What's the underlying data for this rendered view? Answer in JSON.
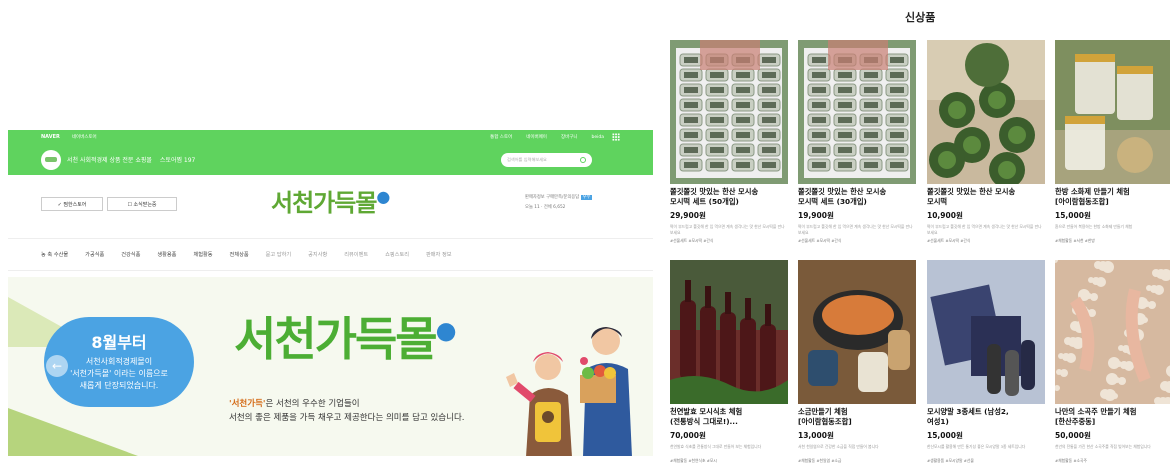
{
  "store": {
    "topbar": {
      "naver": "NAVER",
      "smartstore": "네이버스토어",
      "links": [
        "통합 스토어",
        "네이버페이",
        "장바구니",
        "beida"
      ]
    },
    "header": {
      "description": "서천 사회적경제 상품 전문 쇼핑몰",
      "store_count": "스토어찜 197",
      "search_placeholder": "검색어를 입력해보세요"
    },
    "buttons": {
      "favorite": "✓ 찜한스토어",
      "subscribe": "☐ 소식받는중"
    },
    "logo": "서천가득몰",
    "info": {
      "line1": "판매자정보  구매만족/문의응답",
      "badge": "우수",
      "line2": "오늘 11 · 전체 6,652"
    },
    "categories": [
      {
        "label": "농 축 수산물",
        "dim": false
      },
      {
        "label": "가공식품",
        "dim": false
      },
      {
        "label": "건강식품",
        "dim": false
      },
      {
        "label": "생활용품",
        "dim": false
      },
      {
        "label": "체험활동",
        "dim": false
      },
      {
        "label": "전체상품",
        "dim": false
      },
      {
        "label": "묻고 답하기",
        "dim": true
      },
      {
        "label": "공지사항",
        "dim": true
      },
      {
        "label": "리뷰이벤트",
        "dim": true
      },
      {
        "label": "쇼핑스토리",
        "dim": true
      },
      {
        "label": "판매자 정보",
        "dim": true
      }
    ],
    "banner": {
      "bubble_title": "8월부터",
      "bubble_line1": "서천사회적경제몰이",
      "bubble_line2": "'서천가득몰' 이라는 이름으로",
      "bubble_line3": "새롭게 단장되었습니다.",
      "logo": "서천가득몰",
      "sub_highlight": "'서천가득'",
      "sub_line1_rest": "은 서천의 우수한 기업들이",
      "sub_line2": "서천의 좋은 제품을 가득 채우고 제공한다는 의미를 담고 있습니다."
    }
  },
  "new_products": {
    "title": "신상품",
    "items": [
      {
        "name1": "쫄깃쫄깃 맛있는 한산 모시송",
        "name2": "모시떡 세트 (50개입)",
        "price": "29,900원",
        "desc": "떡이 부드럽고 쫄깃해 한 입 먹으면 계속 생각나는 맛 한산 모시떡을 만나보세요",
        "tags": "#선물세트 #모시떡 #간식",
        "img": "riceA"
      },
      {
        "name1": "쫄깃쫄깃 맛있는 한산 모시송",
        "name2": "모시떡 세트 (30개입)",
        "price": "19,900원",
        "desc": "떡이 부드럽고 쫄깃해 한 입 먹으면 계속 생각나는 맛 한산 모시떡을 만나보세요",
        "tags": "#선물세트 #모시떡 #간식",
        "img": "riceA"
      },
      {
        "name1": "쫄깃쫄깃 맛있는 한산 모시송",
        "name2": "모시떡",
        "price": "10,900원",
        "desc": "떡이 부드럽고 쫄깃해 한 입 먹으면 계속 생각나는 맛 한산 모시떡을 만나보세요",
        "tags": "#선물세트 #모시떡 #간식",
        "img": "greencake"
      },
      {
        "name1": "한방 소화제 만들기 체험",
        "name2": "[아이람협동조합]",
        "price": "15,000원",
        "desc": "환으로 만들어 복용하는 한방 소화제 만들기 체험",
        "tags": "#체험활동 #서천 #한방",
        "img": "jars"
      },
      {
        "name1": "천연발효 모시식초 체험",
        "name2": "(전통방식 그대로!)...",
        "price": "70,000원",
        "desc": "천연발효 식초를 전통방식 그대로 만들어 보는 체험입니다",
        "tags": "#체험활동 #천연식초 #모시",
        "img": "bottles"
      },
      {
        "name1": "소금만들기 체험",
        "name2": "[아이람협동조합]",
        "price": "13,000원",
        "desc": "서천 천일염으로 건강한 소금을 직접 만들어 봅니다",
        "tags": "#체험활동 #천일염 #소금",
        "img": "salt"
      },
      {
        "name1": "모시양말 3종세트 (남성2,",
        "name2": "여성1)",
        "price": "15,000원",
        "desc": "한산모시를 활용해 만든 통기성 좋은 모시양말 3종 세트입니다",
        "tags": "#생활용품 #모시양말 #선물",
        "img": "socks"
      },
      {
        "name1": "나만의 소곡주 만들기 체험",
        "name2": "[한산주중동]",
        "price": "50,000원",
        "desc": "천년의 전통을 가진 한산 소곡주를 직접 빚어보는 체험입니다",
        "tags": "#체험활동 #소곡주",
        "img": "brew"
      }
    ]
  },
  "colors": {
    "brand_green": "#5fd35e",
    "accent_blue": "#4ba3e3",
    "logo_green": "#4cae34"
  }
}
